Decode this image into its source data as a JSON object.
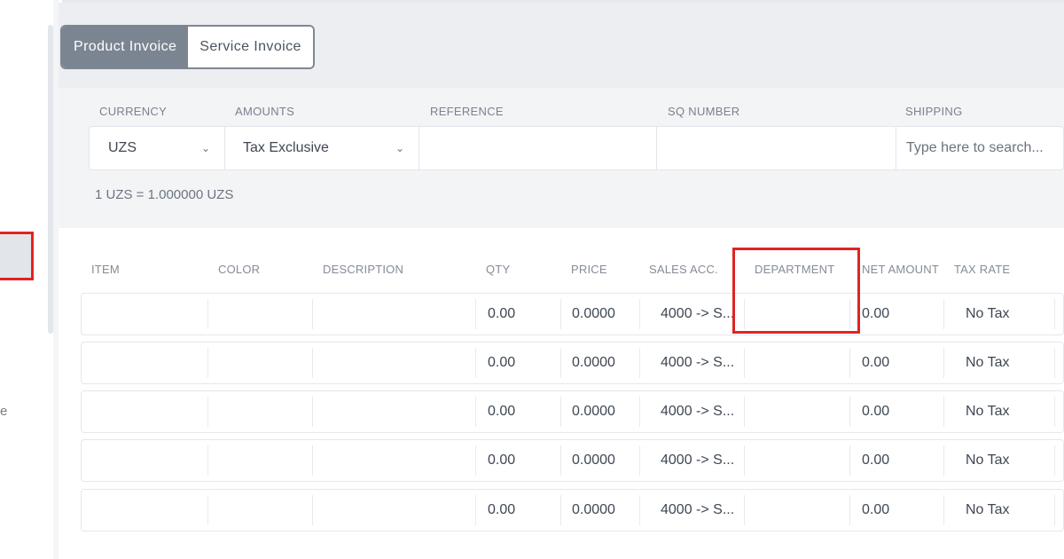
{
  "sidebar": {
    "trailing_text": "e"
  },
  "tabs": [
    {
      "label": "Product Invoice",
      "active": true
    },
    {
      "label": "Service Invoice",
      "active": false
    }
  ],
  "form": {
    "labels": {
      "currency": "CURRENCY",
      "amounts": "AMOUNTS",
      "reference": "REFERENCE",
      "sq_number": "SQ NUMBER",
      "shipping": "SHIPPING"
    },
    "currency_value": "UZS",
    "amounts_value": "Tax Exclusive",
    "reference_value": "",
    "sq_number_value": "",
    "shipping_placeholder": "Type here to search...",
    "exchange_rate": "1 UZS = 1.000000 UZS"
  },
  "table": {
    "columns": [
      "ITEM",
      "COLOR",
      "DESCRIPTION",
      "QTY",
      "PRICE",
      "SALES ACC.",
      "DEPARTMENT",
      "NET AMOUNT",
      "TAX RATE"
    ],
    "rows": [
      {
        "item": "",
        "color": "",
        "description": "",
        "qty": "0.00",
        "price": "0.0000",
        "sales_acc": "4000 -> S...",
        "department": "",
        "net_amount": "0.00",
        "tax_rate": "No Tax"
      },
      {
        "item": "",
        "color": "",
        "description": "",
        "qty": "0.00",
        "price": "0.0000",
        "sales_acc": "4000 -> S...",
        "department": "",
        "net_amount": "0.00",
        "tax_rate": "No Tax"
      },
      {
        "item": "",
        "color": "",
        "description": "",
        "qty": "0.00",
        "price": "0.0000",
        "sales_acc": "4000 -> S...",
        "department": "",
        "net_amount": "0.00",
        "tax_rate": "No Tax"
      },
      {
        "item": "",
        "color": "",
        "description": "",
        "qty": "0.00",
        "price": "0.0000",
        "sales_acc": "4000 -> S...",
        "department": "",
        "net_amount": "0.00",
        "tax_rate": "No Tax"
      },
      {
        "item": "",
        "color": "",
        "description": "",
        "qty": "0.00",
        "price": "0.0000",
        "sales_acc": "4000 -> S...",
        "department": "",
        "net_amount": "0.00",
        "tax_rate": "No Tax"
      }
    ]
  },
  "colors": {
    "highlight": "#e02424",
    "active_tab": "#7b8592"
  },
  "icons": {
    "dropdown": "chevron-down-icon"
  }
}
